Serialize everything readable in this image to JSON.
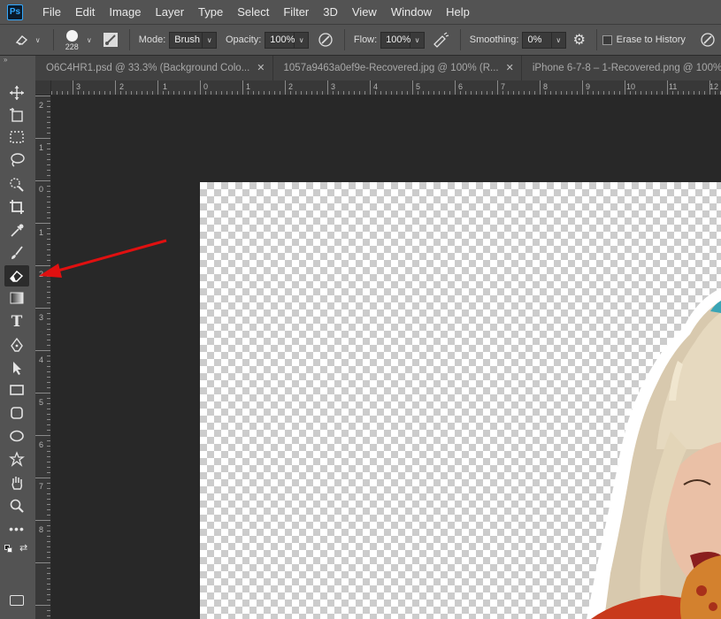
{
  "app": {
    "logo": "Ps"
  },
  "menu": [
    "File",
    "Edit",
    "Image",
    "Layer",
    "Type",
    "Select",
    "Filter",
    "3D",
    "View",
    "Window",
    "Help"
  ],
  "options": {
    "brush_size": "228",
    "mode_label": "Mode:",
    "mode_value": "Brush",
    "opacity_label": "Opacity:",
    "opacity_value": "100%",
    "flow_label": "Flow:",
    "flow_value": "100%",
    "smoothing_label": "Smoothing:",
    "smoothing_value": "0%",
    "erase_history_label": "Erase to History"
  },
  "tabs": [
    {
      "label": "O6C4HR1.psd @ 33.3% (Background Colo..."
    },
    {
      "label": "1057a9463a0ef9e-Recovered.jpg @ 100% (R..."
    },
    {
      "label": "iPhone 6-7-8 – 1-Recovered.png @ 100% ("
    }
  ],
  "ruler_top": [
    "3",
    "2",
    "1",
    "0",
    "1",
    "2",
    "3",
    "4",
    "5",
    "6",
    "7",
    "8",
    "9",
    "10",
    "11",
    "12"
  ],
  "ruler_left": [
    "2",
    "1",
    "0",
    "1",
    "2",
    "3",
    "4",
    "5",
    "6",
    "7",
    "8"
  ],
  "tools": [
    "move-tool",
    "artboard-tool",
    "marquee-tool",
    "lasso-tool",
    "quick-select-tool",
    "crop-tool",
    "eyedropper-tool",
    "brush-tool",
    "eraser-tool",
    "gradient-tool",
    "type-tool",
    "pen-tool",
    "path-select-tool",
    "rectangle-tool",
    "rounded-rect-tool",
    "ellipse-tool",
    "custom-shape-tool",
    "hand-tool",
    "zoom-tool",
    "more-tools"
  ],
  "colors": {
    "foreground": "#c9211e",
    "background": "#ffffff",
    "annotation_arrow": "#e01010"
  },
  "tool_glyphs": {
    "type": "T"
  }
}
